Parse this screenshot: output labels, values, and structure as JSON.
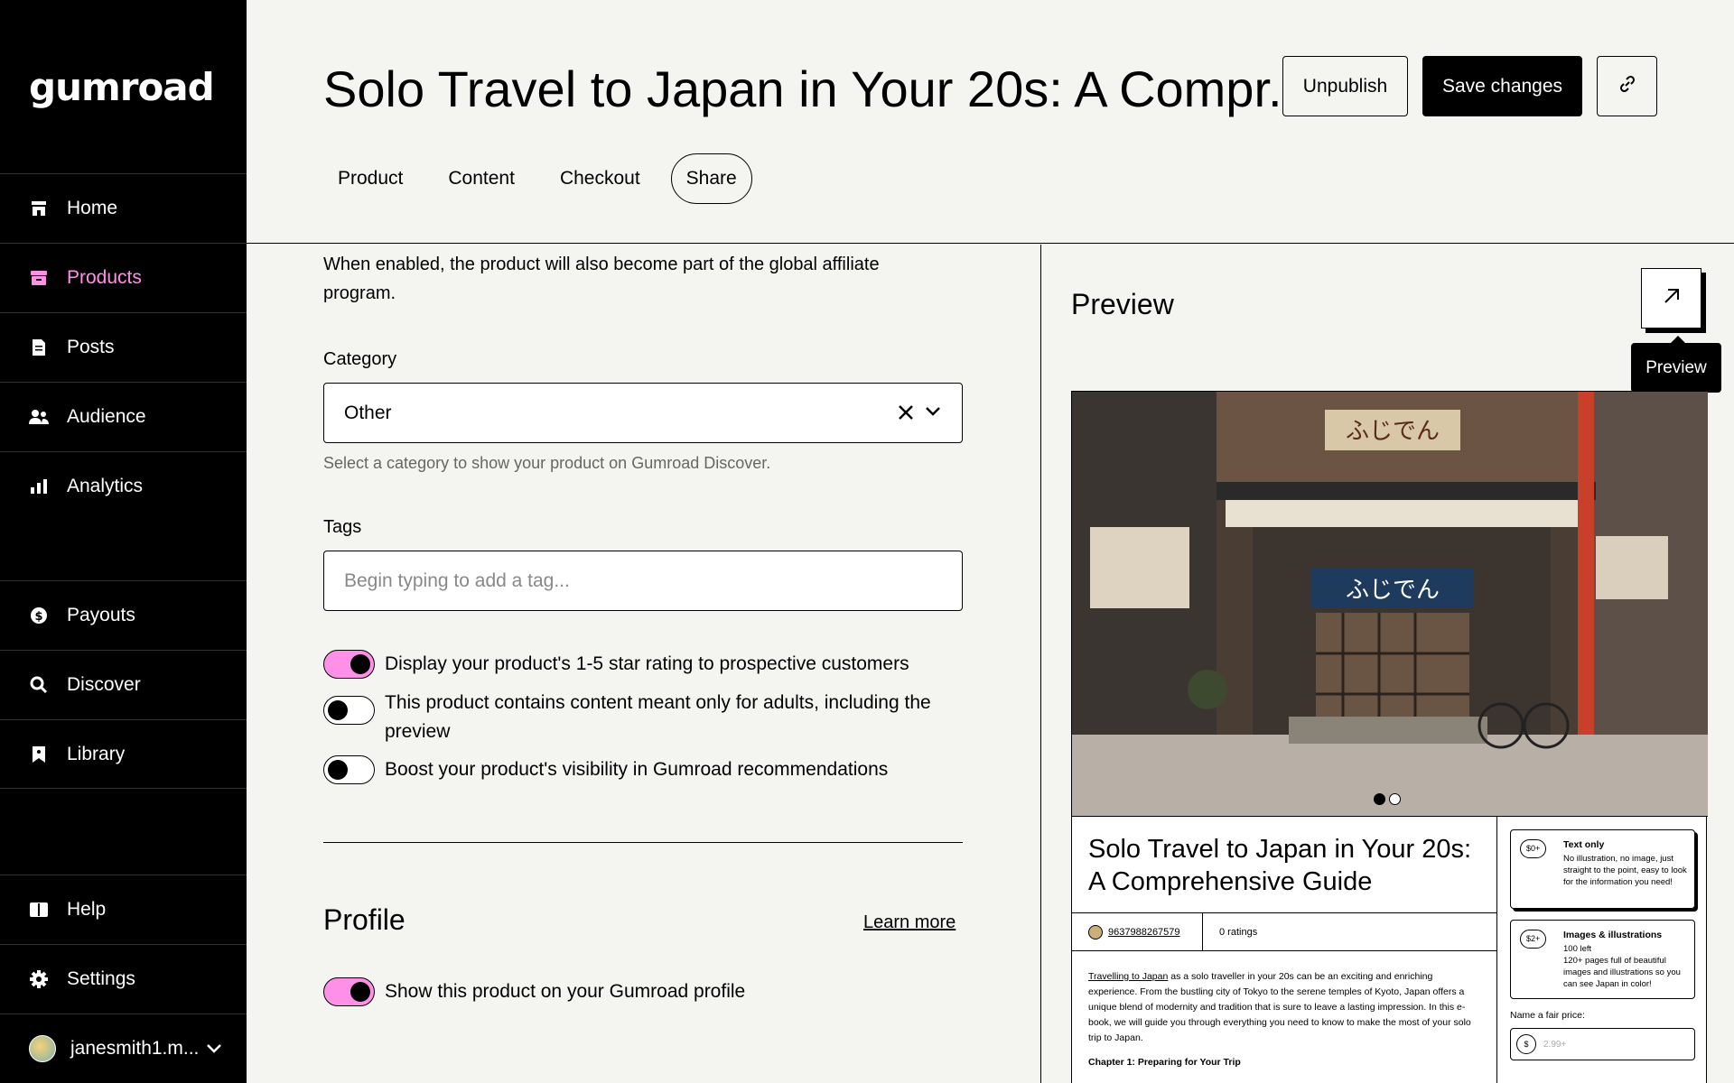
{
  "app": {
    "logo": "gumroad"
  },
  "sidebar": {
    "items": [
      {
        "label": "Home",
        "icon": "store-icon"
      },
      {
        "label": "Products",
        "icon": "archive-icon",
        "active": true
      },
      {
        "label": "Posts",
        "icon": "document-icon"
      },
      {
        "label": "Audience",
        "icon": "people-icon"
      },
      {
        "label": "Analytics",
        "icon": "bar-chart-icon"
      },
      {
        "label": "Payouts",
        "icon": "dollar-circle-icon"
      },
      {
        "label": "Discover",
        "icon": "search-icon"
      },
      {
        "label": "Library",
        "icon": "bookmark-icon"
      },
      {
        "label": "Help",
        "icon": "book-icon"
      },
      {
        "label": "Settings",
        "icon": "gear-icon"
      }
    ],
    "user": "janesmith1.m..."
  },
  "header": {
    "title": "Solo Travel to Japan in Your 20s: A Compr...",
    "unpublish": "Unpublish",
    "save": "Save changes",
    "tabs": [
      "Product",
      "Content",
      "Checkout",
      "Share"
    ],
    "active_tab": "Share"
  },
  "form": {
    "affiliate_desc": "When enabled, the product will also become part of the global affiliate program.",
    "category_label": "Category",
    "category_value": "Other",
    "category_hint": "Select a category to show your product on Gumroad Discover.",
    "tags_label": "Tags",
    "tags_placeholder": "Begin typing to add a tag...",
    "toggles": [
      {
        "label": "Display your product's 1-5 star rating to prospective customers",
        "on": true
      },
      {
        "label": "This product contains content meant only for adults, including the preview",
        "on": false
      },
      {
        "label": "Boost your product's visibility in Gumroad recommendations",
        "on": false
      }
    ],
    "profile_heading": "Profile",
    "learn_more": "Learn more",
    "profile_toggle": {
      "label": "Show this product on your Gumroad profile",
      "on": true
    }
  },
  "preview": {
    "heading": "Preview",
    "tooltip": "Preview",
    "product_title": "Solo Travel to Japan in Your 20s: A Comprehensive Guide",
    "seller": "9637988267579",
    "ratings": "0 ratings",
    "body_link": "Travelling to Japan",
    "body": " as a solo traveller in your 20s can be an exciting and enriching experience. From the bustling city of Tokyo to the serene temples of Kyoto, Japan offers a unique blend of modernity and tradition that is sure to leave a lasting impression. In this e-book, we will guide you through everything you need to know to make the most of your solo trip to Japan.",
    "chapter": "Chapter 1: Preparing for Your Trip",
    "options": [
      {
        "price": "$0+",
        "name": "Text only",
        "desc": "No illustration, no image, just straight to the point, easy to look for the information you need!"
      },
      {
        "price": "$2+",
        "name": "Images & illustrations",
        "left": "100 left",
        "desc": "120+ pages full of beautiful images and illustrations so you can see Japan in color!"
      }
    ],
    "fair_price_label": "Name a fair price:",
    "currency": "$",
    "price_placeholder": "2.99+"
  },
  "colors": {
    "accent": "#ff90e8",
    "background": "#f4f4f0",
    "sidebar": "#000000"
  }
}
